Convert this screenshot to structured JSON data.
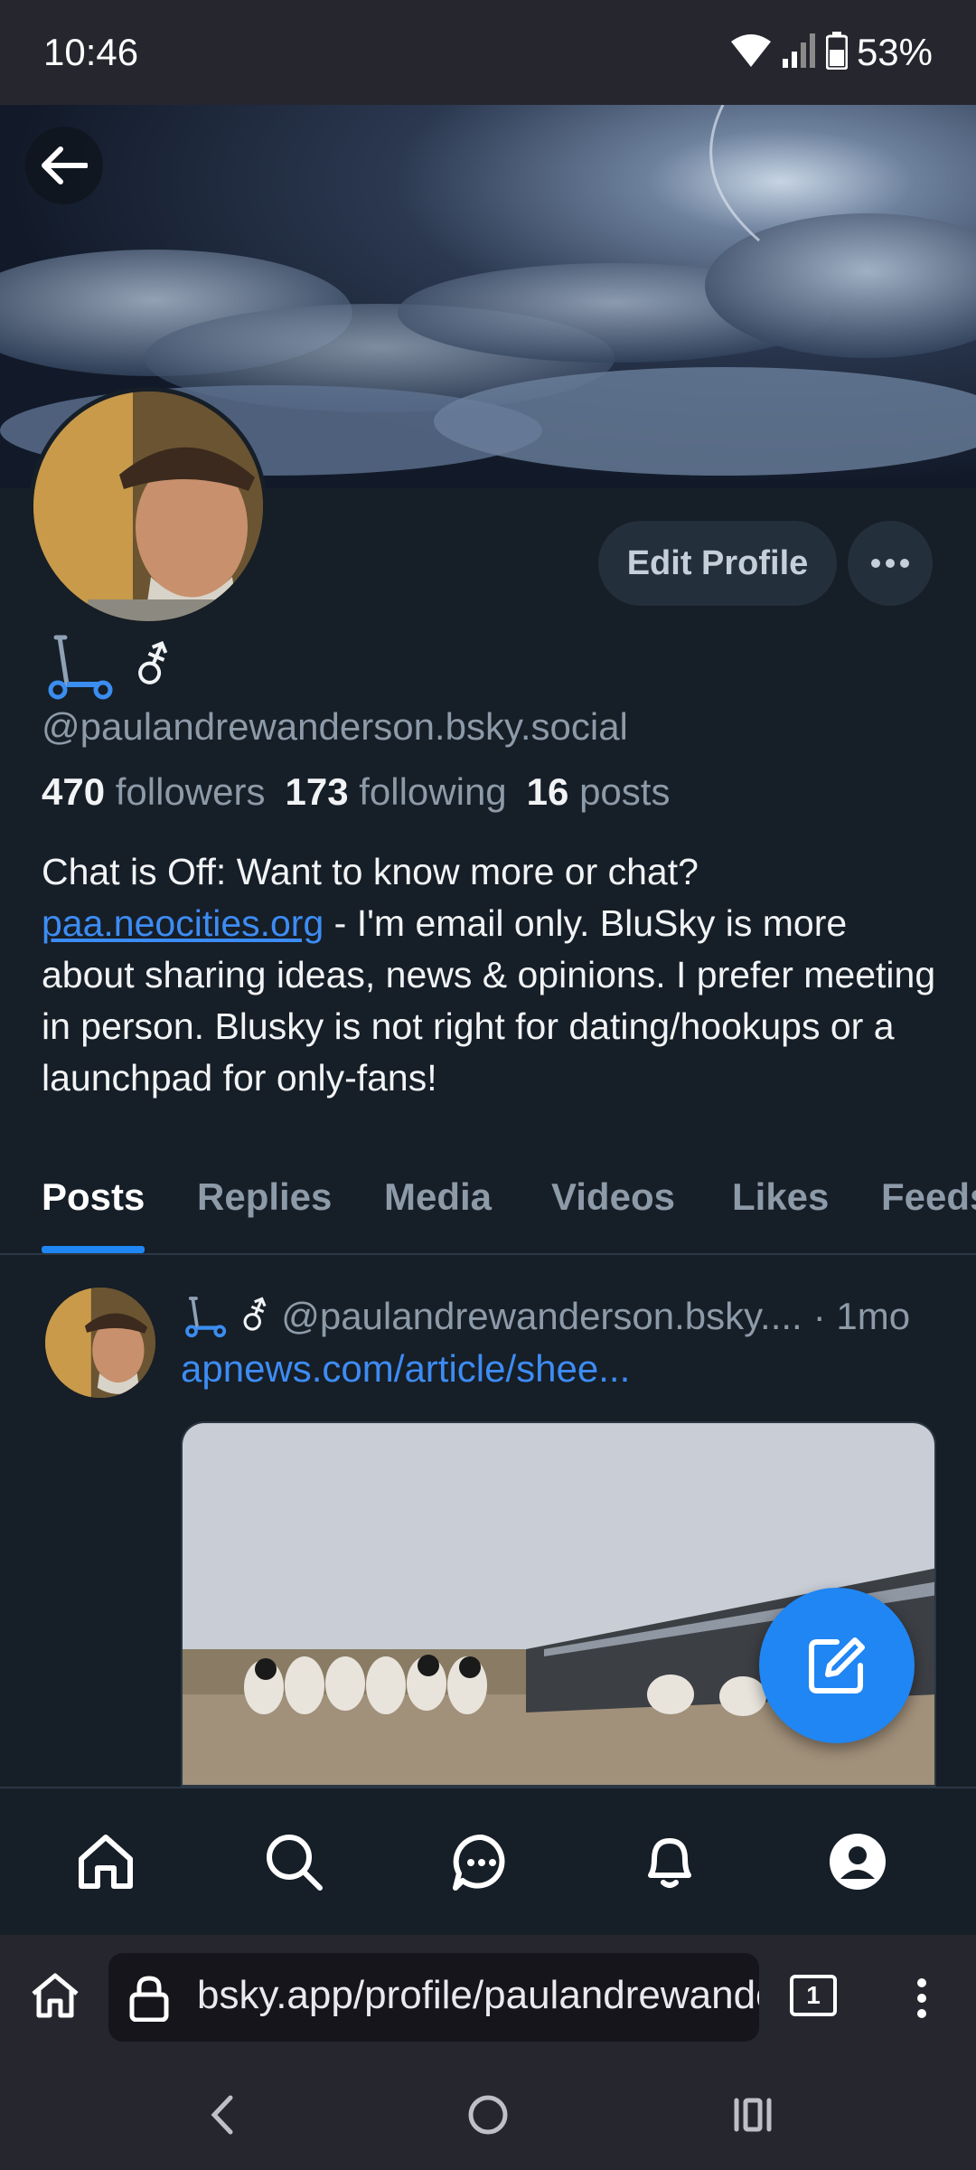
{
  "status_bar": {
    "time": "10:46",
    "battery": "53%"
  },
  "profile": {
    "edit_button": "Edit Profile",
    "name_symbol": "⚦",
    "handle": "@paulandrewanderson.bsky.social",
    "stats": {
      "followers_count": "470",
      "followers_label": "followers",
      "following_count": "173",
      "following_label": "following",
      "posts_count": "16",
      "posts_label": "posts"
    },
    "bio_prefix": "Chat is Off: Want to know more or chat?",
    "bio_link": "paa.neocities.org",
    "bio_suffix": " - I'm email only. BluSky is more about sharing ideas, news & opinions. I prefer meeting in person. Blusky is not right for dating/hookups or a launchpad for only-fans!"
  },
  "tabs": [
    "Posts",
    "Replies",
    "Media",
    "Videos",
    "Likes",
    "Feeds"
  ],
  "post": {
    "symbol": "⚦",
    "handle": "@paulandrewanderson.bsky....",
    "time": "· 1mo",
    "link": "apnews.com/article/shee..."
  },
  "browser": {
    "url": "bsky.app/profile/paulandrewanderson",
    "tab_count": "1"
  },
  "colors": {
    "accent": "#1f86f4",
    "background": "#161e27",
    "link": "#3d8cf3"
  }
}
